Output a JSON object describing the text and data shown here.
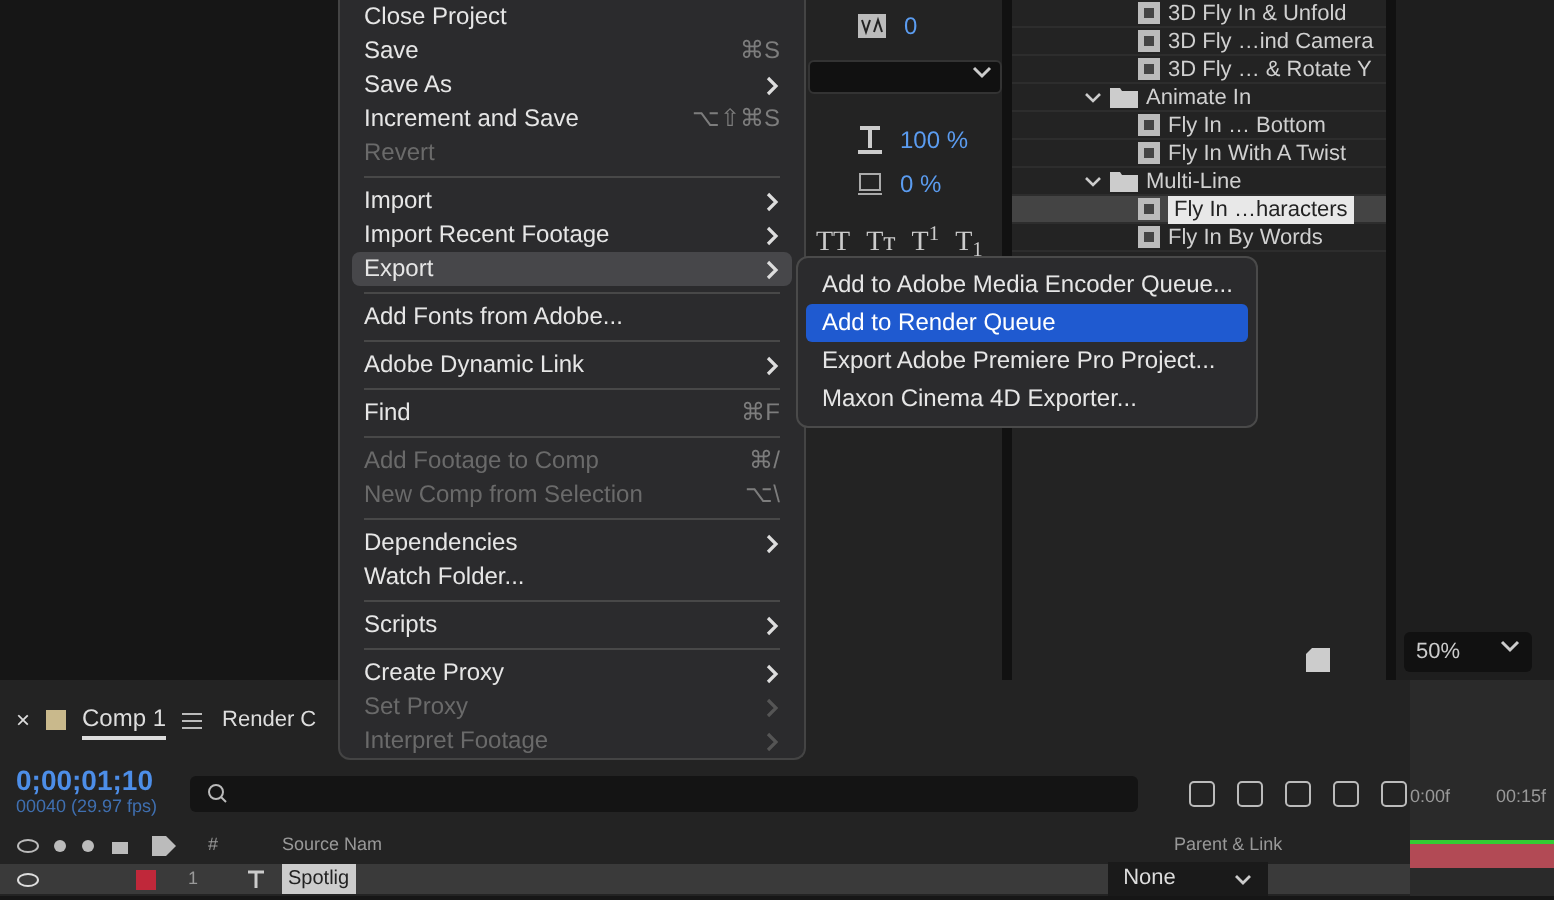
{
  "file_menu": {
    "items": [
      {
        "kind": "item",
        "label": "Close Project",
        "submenu": false,
        "disabled": false,
        "selected": false
      },
      {
        "kind": "item",
        "label": "Save",
        "shortcut": "⌘S",
        "submenu": false,
        "disabled": false,
        "selected": false
      },
      {
        "kind": "item",
        "label": "Save As",
        "submenu": true,
        "disabled": false,
        "selected": false
      },
      {
        "kind": "item",
        "label": "Increment and Save",
        "shortcut": "⌥⇧⌘S",
        "submenu": false,
        "disabled": false,
        "selected": false
      },
      {
        "kind": "item",
        "label": "Revert",
        "submenu": false,
        "disabled": true,
        "selected": false
      },
      {
        "kind": "separator"
      },
      {
        "kind": "item",
        "label": "Import",
        "submenu": true,
        "disabled": false,
        "selected": false
      },
      {
        "kind": "item",
        "label": "Import Recent Footage",
        "submenu": true,
        "disabled": false,
        "selected": false
      },
      {
        "kind": "item",
        "label": "Export",
        "submenu": true,
        "disabled": false,
        "selected": true
      },
      {
        "kind": "separator"
      },
      {
        "kind": "item",
        "label": "Add Fonts from Adobe...",
        "submenu": false,
        "disabled": false,
        "selected": false
      },
      {
        "kind": "separator"
      },
      {
        "kind": "item",
        "label": "Adobe Dynamic Link",
        "submenu": true,
        "disabled": false,
        "selected": false
      },
      {
        "kind": "separator"
      },
      {
        "kind": "item",
        "label": "Find",
        "shortcut": "⌘F",
        "submenu": false,
        "disabled": false,
        "selected": false
      },
      {
        "kind": "separator"
      },
      {
        "kind": "item",
        "label": "Add Footage to Comp",
        "shortcut": "⌘/",
        "submenu": false,
        "disabled": true,
        "selected": false
      },
      {
        "kind": "item",
        "label": "New Comp from Selection",
        "shortcut": "⌥\\",
        "submenu": false,
        "disabled": true,
        "selected": false
      },
      {
        "kind": "separator"
      },
      {
        "kind": "item",
        "label": "Dependencies",
        "submenu": true,
        "disabled": false,
        "selected": false
      },
      {
        "kind": "item",
        "label": "Watch Folder...",
        "submenu": false,
        "disabled": false,
        "selected": false
      },
      {
        "kind": "separator"
      },
      {
        "kind": "item",
        "label": "Scripts",
        "submenu": true,
        "disabled": false,
        "selected": false
      },
      {
        "kind": "separator"
      },
      {
        "kind": "item",
        "label": "Create Proxy",
        "submenu": true,
        "disabled": false,
        "selected": false
      },
      {
        "kind": "item",
        "label": "Set Proxy",
        "submenu": true,
        "disabled": true,
        "selected": false
      },
      {
        "kind": "item",
        "label": "Interpret Footage",
        "submenu": true,
        "disabled": true,
        "selected": false
      }
    ]
  },
  "export_submenu": {
    "items": [
      {
        "label": "Add to Adobe Media Encoder Queue...",
        "selected": false
      },
      {
        "label": "Add to Render Queue",
        "selected": true
      },
      {
        "label": "Export Adobe Premiere Pro Project...",
        "selected": false
      },
      {
        "label": "Maxon Cinema 4D Exporter...",
        "selected": false
      }
    ]
  },
  "character_panel": {
    "tracking": "0",
    "scale": "100 %",
    "baseline_shift": "0 %",
    "style_buttons": [
      "TT",
      "Tт",
      "T$^{1}$",
      "T$_{1}$"
    ]
  },
  "project_tree": [
    {
      "kind": "comp",
      "label": "3D Fly In & Unfold",
      "selected": false
    },
    {
      "kind": "comp",
      "label": "3D Fly …ind Camera",
      "selected": false
    },
    {
      "kind": "comp",
      "label": "3D Fly … & Rotate Y",
      "selected": false
    },
    {
      "kind": "folder",
      "label": "Animate In",
      "expanded": true,
      "children": [
        {
          "kind": "comp",
          "label": "Fly In … Bottom",
          "selected": false
        },
        {
          "kind": "comp",
          "label": "Fly In With A Twist",
          "selected": false
        }
      ]
    },
    {
      "kind": "folder",
      "label": "Multi-Line",
      "expanded": true,
      "children": [
        {
          "kind": "comp",
          "label": "Fly In …haracters",
          "selected": true
        },
        {
          "kind": "comp",
          "label": "Fly In By Words",
          "selected": false
        }
      ]
    }
  ],
  "viewer": {
    "zoom": "50%"
  },
  "timeline": {
    "tabs": [
      {
        "label": "Comp 1",
        "selected": true
      },
      {
        "label": "Render C",
        "selected": false
      }
    ],
    "timecode": "0;00;01;10",
    "frame_info": "00040 (29.97 fps)",
    "columns": {
      "number": "#",
      "source_name": "Source Nam",
      "parent": "Parent & Link"
    },
    "layers": [
      {
        "number": "1",
        "name": "Spotlig",
        "parent": "None",
        "visible": true
      }
    ],
    "ruler": [
      "0:00f",
      "00:15f"
    ],
    "close_label": "×"
  }
}
